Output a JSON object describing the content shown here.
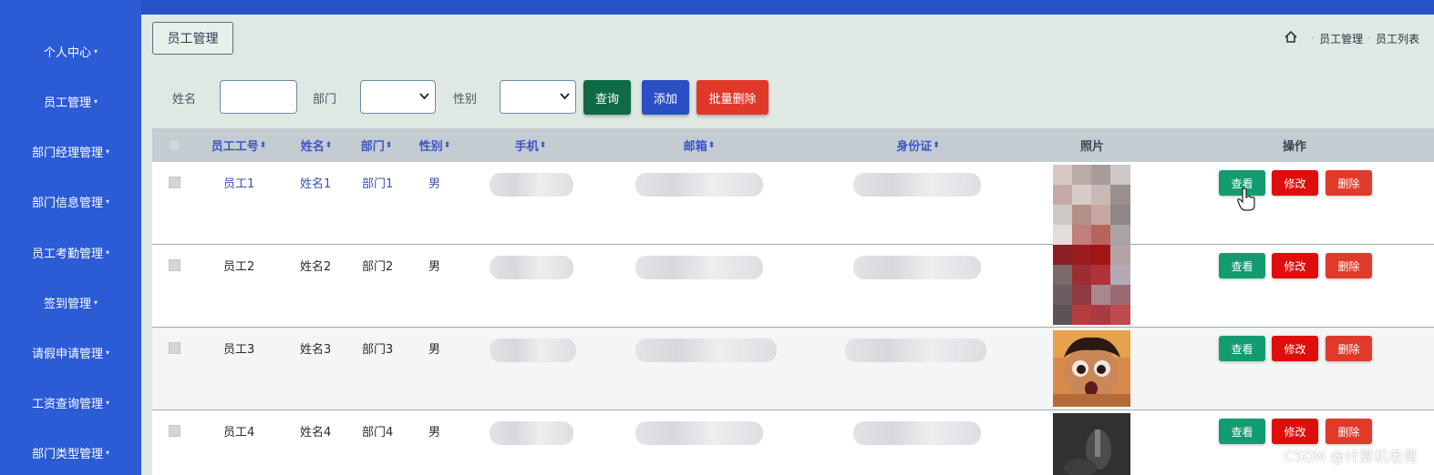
{
  "sidebar": {
    "items": [
      {
        "label": "个人中心"
      },
      {
        "label": "员工管理"
      },
      {
        "label": "部门经理管理"
      },
      {
        "label": "部门信息管理"
      },
      {
        "label": "员工考勤管理"
      },
      {
        "label": "签到管理"
      },
      {
        "label": "请假申请管理"
      },
      {
        "label": "工资查询管理"
      },
      {
        "label": "部门类型管理"
      }
    ],
    "caret": "▾"
  },
  "header": {
    "title": "员工管理",
    "breadcrumb": {
      "home_icon": "home-icon",
      "items": [
        "员工管理",
        "员工列表"
      ]
    }
  },
  "filters": {
    "name_label": "姓名",
    "name_value": "",
    "dept_label": "部门",
    "dept_value": "",
    "gender_label": "性别",
    "gender_value": "",
    "search_button": "查询",
    "add_button": "添加",
    "batch_delete_button": "批量删除"
  },
  "table": {
    "columns": [
      "员工工号",
      "姓名",
      "部门",
      "性别",
      "手机",
      "邮箱",
      "身份证",
      "照片",
      "操作"
    ],
    "sort_icon": "⬍",
    "rows": [
      {
        "id": "员工1",
        "name": "姓名1",
        "dept": "部门1",
        "gender": "男"
      },
      {
        "id": "员工2",
        "name": "姓名2",
        "dept": "部门2",
        "gender": "男"
      },
      {
        "id": "员工3",
        "name": "姓名3",
        "dept": "部门3",
        "gender": "男"
      },
      {
        "id": "员工4",
        "name": "姓名4",
        "dept": "部门4",
        "gender": "男"
      }
    ],
    "actions": {
      "view": "查看",
      "edit": "修改",
      "delete": "删除"
    }
  },
  "colors": {
    "sidebar": "#2c5bd6",
    "search_button": "#0e6b45",
    "add_button": "#2a4fc4",
    "batch_delete_button": "#e0392a",
    "view_button": "#139b72",
    "edit_button": "#e00d0d",
    "delete_button": "#e03a2a"
  },
  "watermark": "CSDN @计算机老哥"
}
